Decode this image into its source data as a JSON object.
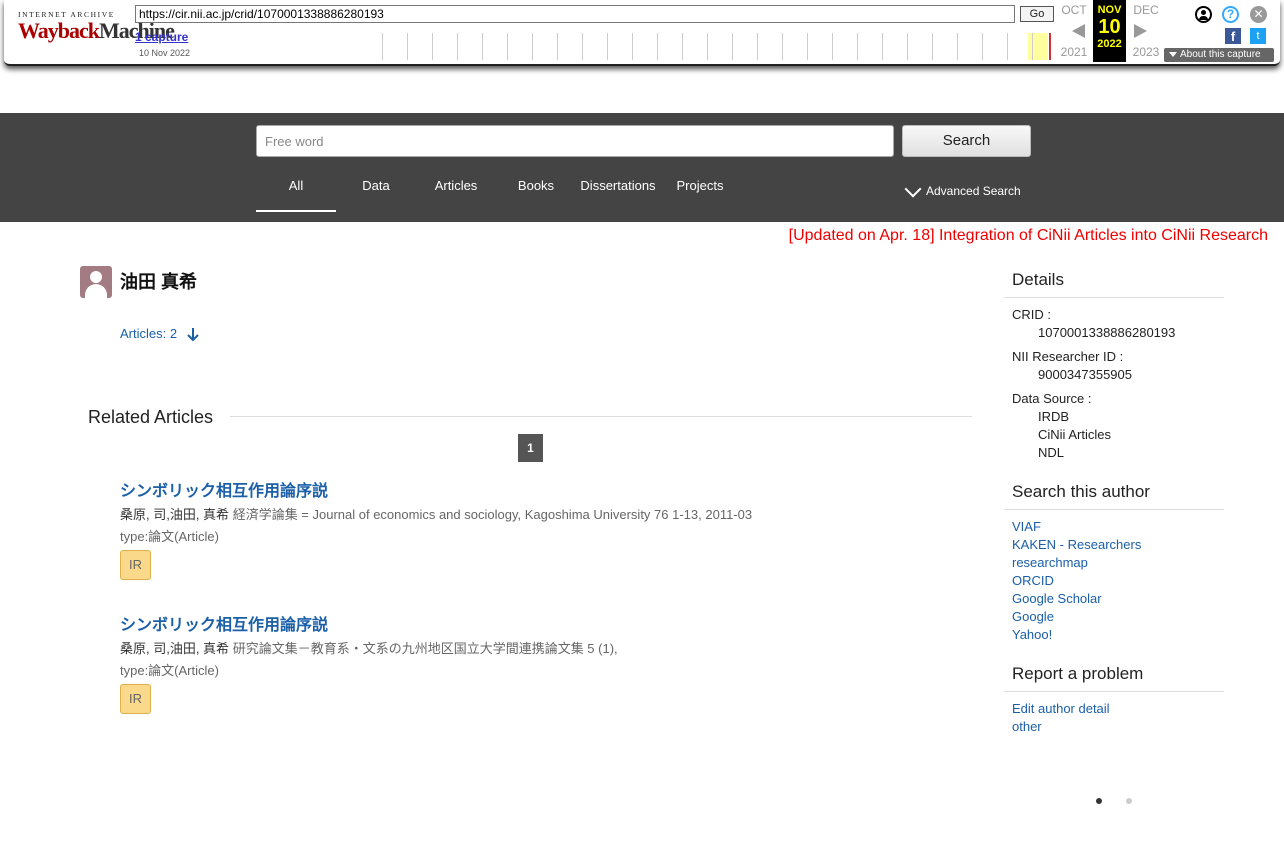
{
  "wayback": {
    "logo_top": "INTERNET ARCHIVE",
    "logo_main_a": "Wayback",
    "logo_main_b": "Machine",
    "url": "https://cir.nii.ac.jp/crid/1070001338886280193",
    "go_label": "Go",
    "captures": "1 capture",
    "capture_date": "10 Nov 2022",
    "prev_month": "OCT",
    "prev_year": "2021",
    "cur_month": "NOV",
    "cur_day": "10",
    "cur_year": "2022",
    "next_month": "DEC",
    "next_year": "2023",
    "about": "About this capture",
    "help_glyph": "?",
    "close_glyph": "✕",
    "fb_glyph": "f",
    "tw_glyph": "t"
  },
  "search": {
    "placeholder": "Free word",
    "button": "Search",
    "tabs": [
      "All",
      "Data",
      "Articles",
      "Books",
      "Dissertations",
      "Projects"
    ],
    "advanced": "Advanced Search"
  },
  "notice": "[Updated on Apr. 18] Integration of CiNii Articles into CiNii Research",
  "author": {
    "name": "油田 真希",
    "articles_link": "Articles: 2"
  },
  "related": {
    "title": "Related Articles",
    "page": "1",
    "articles": [
      {
        "title": "シンボリック相互作用論序説",
        "authors": "桑原, 司,油田, 真希",
        "source": "経済学論集 = Journal of economics and sociology, Kagoshima University 76 1-13, 2011-03",
        "type": "type:論文(Article)",
        "badge": "IR"
      },
      {
        "title": "シンボリック相互作用論序説",
        "authors": "桑原, 司,油田, 真希",
        "source": "研究論文集－教育系・文系の九州地区国立大学間連携論文集 5 (1),",
        "type": "type:論文(Article)",
        "badge": "IR"
      }
    ]
  },
  "details": {
    "title": "Details",
    "crid_label": "CRID :",
    "crid": "1070001338886280193",
    "nii_label": "NII Researcher ID :",
    "nii_id": "9000347355905",
    "source_label": "Data Source :",
    "sources": [
      "IRDB",
      "CiNii Articles",
      "NDL"
    ]
  },
  "search_author": {
    "title": "Search this author",
    "links": [
      "VIAF",
      "KAKEN - Researchers",
      "researchmap",
      "ORCID",
      "Google Scholar",
      "Google",
      "Yahoo!"
    ]
  },
  "report": {
    "title": "Report a problem",
    "links": [
      "Edit author detail",
      "other"
    ]
  },
  "colors": {
    "band": "#444444",
    "link": "#1a5fa8",
    "notice": "#ee0000",
    "badge": "#fbd98a"
  }
}
